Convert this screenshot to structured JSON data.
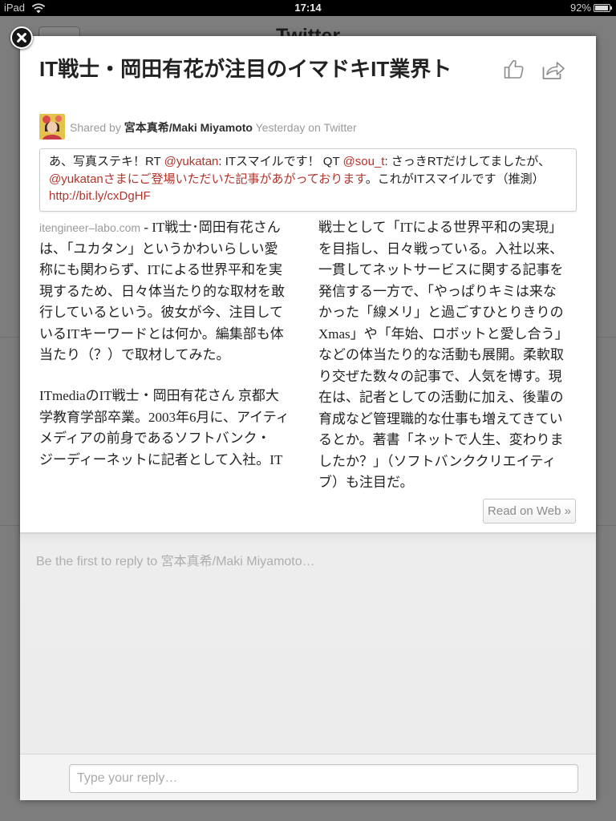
{
  "status_bar": {
    "device": "iPad",
    "time": "17:14",
    "battery": "92%"
  },
  "background_app": {
    "title": "Twitter"
  },
  "modal": {
    "title": "IT戦士・岡田有花が注目のイマドキIT業界ト",
    "icons": {
      "close": "close-icon",
      "like": "thumbs-up-icon",
      "share": "share-icon"
    },
    "shared_by": {
      "prefix": "Shared by",
      "author": "宮本真希/Maki Miyamoto",
      "meta": "Yesterday on Twitter"
    },
    "tweet": [
      {
        "text": "あ、写真ステキ！RT ",
        "link": false
      },
      {
        "text": "@yukatan",
        "link": true
      },
      {
        "text": ": ITスマイルです！ QT ",
        "link": false
      },
      {
        "text": "@sou_t",
        "link": true
      },
      {
        "text": ": さっきRTだけしてましたが、",
        "link": false
      },
      {
        "text": "@yukatanさまにご登場いただいた記事があがっております",
        "link": true
      },
      {
        "text": "。これがITスマイルです（推測） ",
        "link": false
      },
      {
        "text": "http://bit.ly/cxDgHF",
        "link": true
      }
    ],
    "article": {
      "source": "itengineer–labo.com",
      "separator": " - ",
      "left_column": [
        [
          "IT戦士･岡田有花さん",
          "は、「ユカタン」というかわいらしい愛",
          "称にも関わらず、ITによる世界平和を実",
          "現するため、日々体当たり的な取材を敢",
          "行しているという。彼女が今、注目して",
          "いるITキーワードとは何か。編集部も体",
          "当たり（？）で取材してみた。"
        ],
        [
          "ITmediaのIT戦士・岡田有花さん 京都大",
          "学教育学部卒業。2003年6月に、アイティ",
          "メディアの前身であるソフトバンク・",
          "ジーディーネットに記者として入社。IT"
        ]
      ],
      "right_column": [
        "戦士として「ITによる世界平和の実現」",
        "を目指し、日々戦っている。入社以来、",
        "一貫してネットサービスに関する記事を",
        "発信する一方で、「やっぱりキミは来な",
        "かった「線メリ」と過ごすひとりきりの",
        "Xmas」や「年始、ロボットと愛し合う」",
        "などの体当たり的な活動も展開。柔軟取",
        "り交ぜた数々の記事で、人気を博す。現",
        "在は、記者としての活動に加え、後輩の",
        "育成など管理職的な仕事も増えてきてい",
        "るとか。著書「ネットで人生、変わりま",
        "したか？」（ソフトバンククリエイティ",
        "ブ）も注目だ。"
      ]
    },
    "read_on_web": "Read on Web »"
  },
  "reply": {
    "prompt": "Be the first to reply to 宮本真希/Maki Miyamoto…",
    "input_placeholder": "Type your reply…"
  },
  "colors": {
    "link": "#b3332a",
    "overlay": "#7d7d7d",
    "title_text": "#222222",
    "muted_text": "#9a9a9a"
  }
}
